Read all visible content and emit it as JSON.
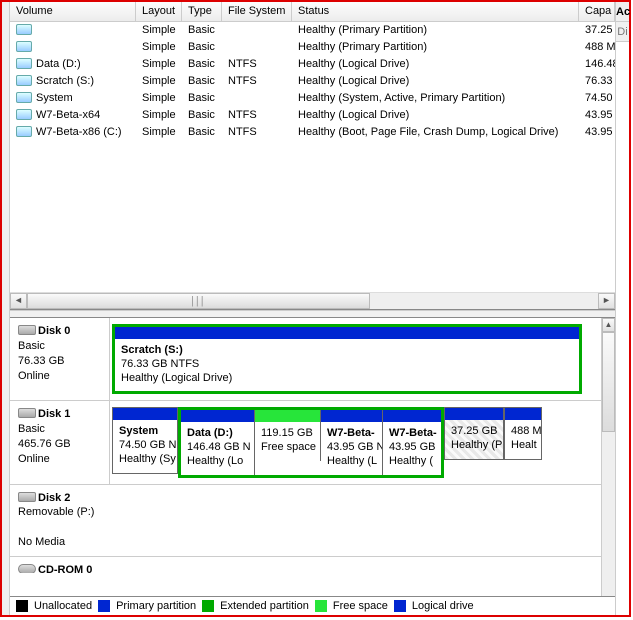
{
  "headers": {
    "volume": "Volume",
    "layout": "Layout",
    "type": "Type",
    "fs": "File System",
    "status": "Status",
    "capacity": "Capa"
  },
  "volumes": [
    {
      "name": "",
      "layout": "Simple",
      "type": "Basic",
      "fs": "",
      "status": "Healthy (Primary Partition)",
      "cap": "37.25"
    },
    {
      "name": "",
      "layout": "Simple",
      "type": "Basic",
      "fs": "",
      "status": "Healthy (Primary Partition)",
      "cap": "488 M"
    },
    {
      "name": "Data (D:)",
      "layout": "Simple",
      "type": "Basic",
      "fs": "NTFS",
      "status": "Healthy (Logical Drive)",
      "cap": "146.48"
    },
    {
      "name": "Scratch (S:)",
      "layout": "Simple",
      "type": "Basic",
      "fs": "NTFS",
      "status": "Healthy (Logical Drive)",
      "cap": "76.33"
    },
    {
      "name": "System",
      "layout": "Simple",
      "type": "Basic",
      "fs": "",
      "status": "Healthy (System, Active, Primary Partition)",
      "cap": "74.50"
    },
    {
      "name": "W7-Beta-x64",
      "layout": "Simple",
      "type": "Basic",
      "fs": "NTFS",
      "status": "Healthy (Logical Drive)",
      "cap": "43.95"
    },
    {
      "name": "W7-Beta-x86 (C:)",
      "layout": "Simple",
      "type": "Basic",
      "fs": "NTFS",
      "status": "Healthy (Boot, Page File, Crash Dump, Logical Drive)",
      "cap": "43.95"
    }
  ],
  "disks": {
    "d0": {
      "title": "Disk 0",
      "type": "Basic",
      "size": "76.33 GB",
      "state": "Online",
      "vol": {
        "name": "Scratch  (S:)",
        "line2": "76.33 GB NTFS",
        "line3": "Healthy (Logical Drive)"
      }
    },
    "d1": {
      "title": "Disk 1",
      "type": "Basic",
      "size": "465.76 GB",
      "state": "Online",
      "blocks": {
        "sys": {
          "name": "System",
          "l2": "74.50 GB N",
          "l3": "Healthy (Sy"
        },
        "data": {
          "name": "Data  (D:)",
          "l2": "146.48 GB N",
          "l3": "Healthy (Lo"
        },
        "free": {
          "name": "",
          "l2": "119.15 GB",
          "l3": "Free space"
        },
        "w64": {
          "name": "W7-Beta-",
          "l2": "43.95 GB N",
          "l3": "Healthy (L"
        },
        "w86": {
          "name": "W7-Beta-",
          "l2": "43.95 GB",
          "l3": "Healthy ("
        },
        "p37": {
          "name": "",
          "l2": "37.25 GB",
          "l3": "Healthy (P"
        },
        "p488": {
          "name": "",
          "l2": "488 M",
          "l3": "Healt"
        }
      }
    },
    "d2": {
      "title": "Disk 2",
      "sub": "Removable (P:)",
      "state": "No Media"
    },
    "cd": {
      "title": "CD-ROM 0"
    }
  },
  "legend": {
    "unalloc": "Unallocated",
    "primary": "Primary partition",
    "extended": "Extended partition",
    "free": "Free space",
    "logical": "Logical drive"
  },
  "right": {
    "tab_a": "Ac",
    "tab_b": "Di"
  }
}
